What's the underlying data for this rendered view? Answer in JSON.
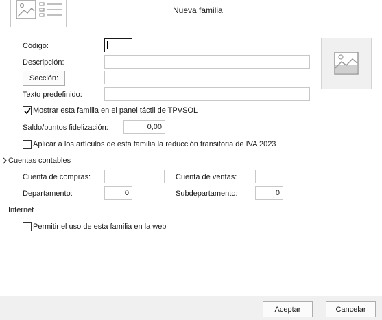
{
  "dialog": {
    "title": "Nueva familia"
  },
  "form": {
    "codigo": {
      "label": "Código:",
      "value": ""
    },
    "descripcion": {
      "label": "Descripción:",
      "value": ""
    },
    "seccion": {
      "button_label": "Sección:",
      "value": ""
    },
    "texto_predefinido": {
      "label": "Texto predefinido:",
      "value": ""
    },
    "mostrar_panel": {
      "label": "Mostrar esta familia en el panel táctil de TPVSOL",
      "checked": true
    },
    "saldo": {
      "label": "Saldo/puntos fidelización:",
      "value": "0,00"
    },
    "reduccion_iva": {
      "label": "Aplicar a los artículos de esta familia la reducción transitoria de IVA 2023",
      "checked": false
    }
  },
  "cuentas": {
    "section_label": "Cuentas contables",
    "compras": {
      "label": "Cuenta de compras:",
      "value": ""
    },
    "ventas": {
      "label": "Cuenta de ventas:",
      "value": ""
    },
    "departamento": {
      "label": "Departamento:",
      "value": "0"
    },
    "subdepartamento": {
      "label": "Subdepartamento:",
      "value": "0"
    }
  },
  "internet": {
    "section_label": "Internet",
    "permitir_web": {
      "label": "Permitir el uso de esta familia en la web",
      "checked": false
    }
  },
  "footer": {
    "accept_label": "Aceptar",
    "cancel_label": "Cancelar"
  },
  "icons": {
    "header": "family-form-icon",
    "image_placeholder": "image-icon",
    "expander": "chevron-right-icon",
    "check": "checkmark-icon"
  },
  "colors": {
    "footer_bg": "#f0f0f0",
    "field_border": "#c8c8c8",
    "text": "#1a1a1a"
  }
}
